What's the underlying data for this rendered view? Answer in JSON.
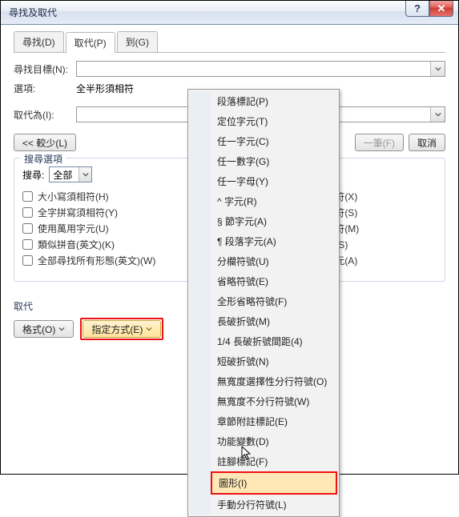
{
  "titlebar": {
    "title": "尋找及取代"
  },
  "tabs": {
    "find": "尋找(D)",
    "replace": "取代(P)",
    "goto": "到(G)"
  },
  "form": {
    "findLabel": "尋找目標(N):",
    "optLabel": "選項:",
    "optValue": "全半形須相符",
    "replaceLabel": "取代為(I):"
  },
  "buttons": {
    "less": "<< 較少(L)",
    "findnext": "一筆(F)",
    "cancel": "取消"
  },
  "fs": {
    "legend": "搜尋選項",
    "searchLabel": "搜尋:",
    "searchValue": "全部",
    "left": {
      "c1": "大小寫須相符(H)",
      "c2": "全字拼寫須相符(Y)",
      "c3": "使用萬用字元(U)",
      "c4": "類似拼音(英文)(K)",
      "c5": "全部尋找所有形態(英文)(W)"
    },
    "right": {
      "c1": "須相符(X)",
      "c2": "須相符(S)",
      "c3": "須相符(M)",
      "c4": "符號(S)",
      "c5": "白字元(A)"
    }
  },
  "replace": {
    "sectionLabel": "取代",
    "format": "格式(O)",
    "special": "指定方式(E)"
  },
  "menu": {
    "items": [
      "段落標記(P)",
      "定位字元(T)",
      "任一字元(C)",
      "任一數字(G)",
      "任一字母(Y)",
      "^ 字元(R)",
      "§ 節字元(A)",
      "¶ 段落字元(A)",
      "分欄符號(U)",
      "省略符號(E)",
      "全形省略符號(F)",
      "長破折號(M)",
      "1/4 長破折號間距(4)",
      "短破折號(N)",
      "無寬度選擇性分行符號(O)",
      "無寬度不分行符號(W)",
      "章節附註標記(E)",
      "功能變數(D)",
      "註腳標記(F)",
      "圖形(I)",
      "手動分行符號(L)"
    ]
  }
}
